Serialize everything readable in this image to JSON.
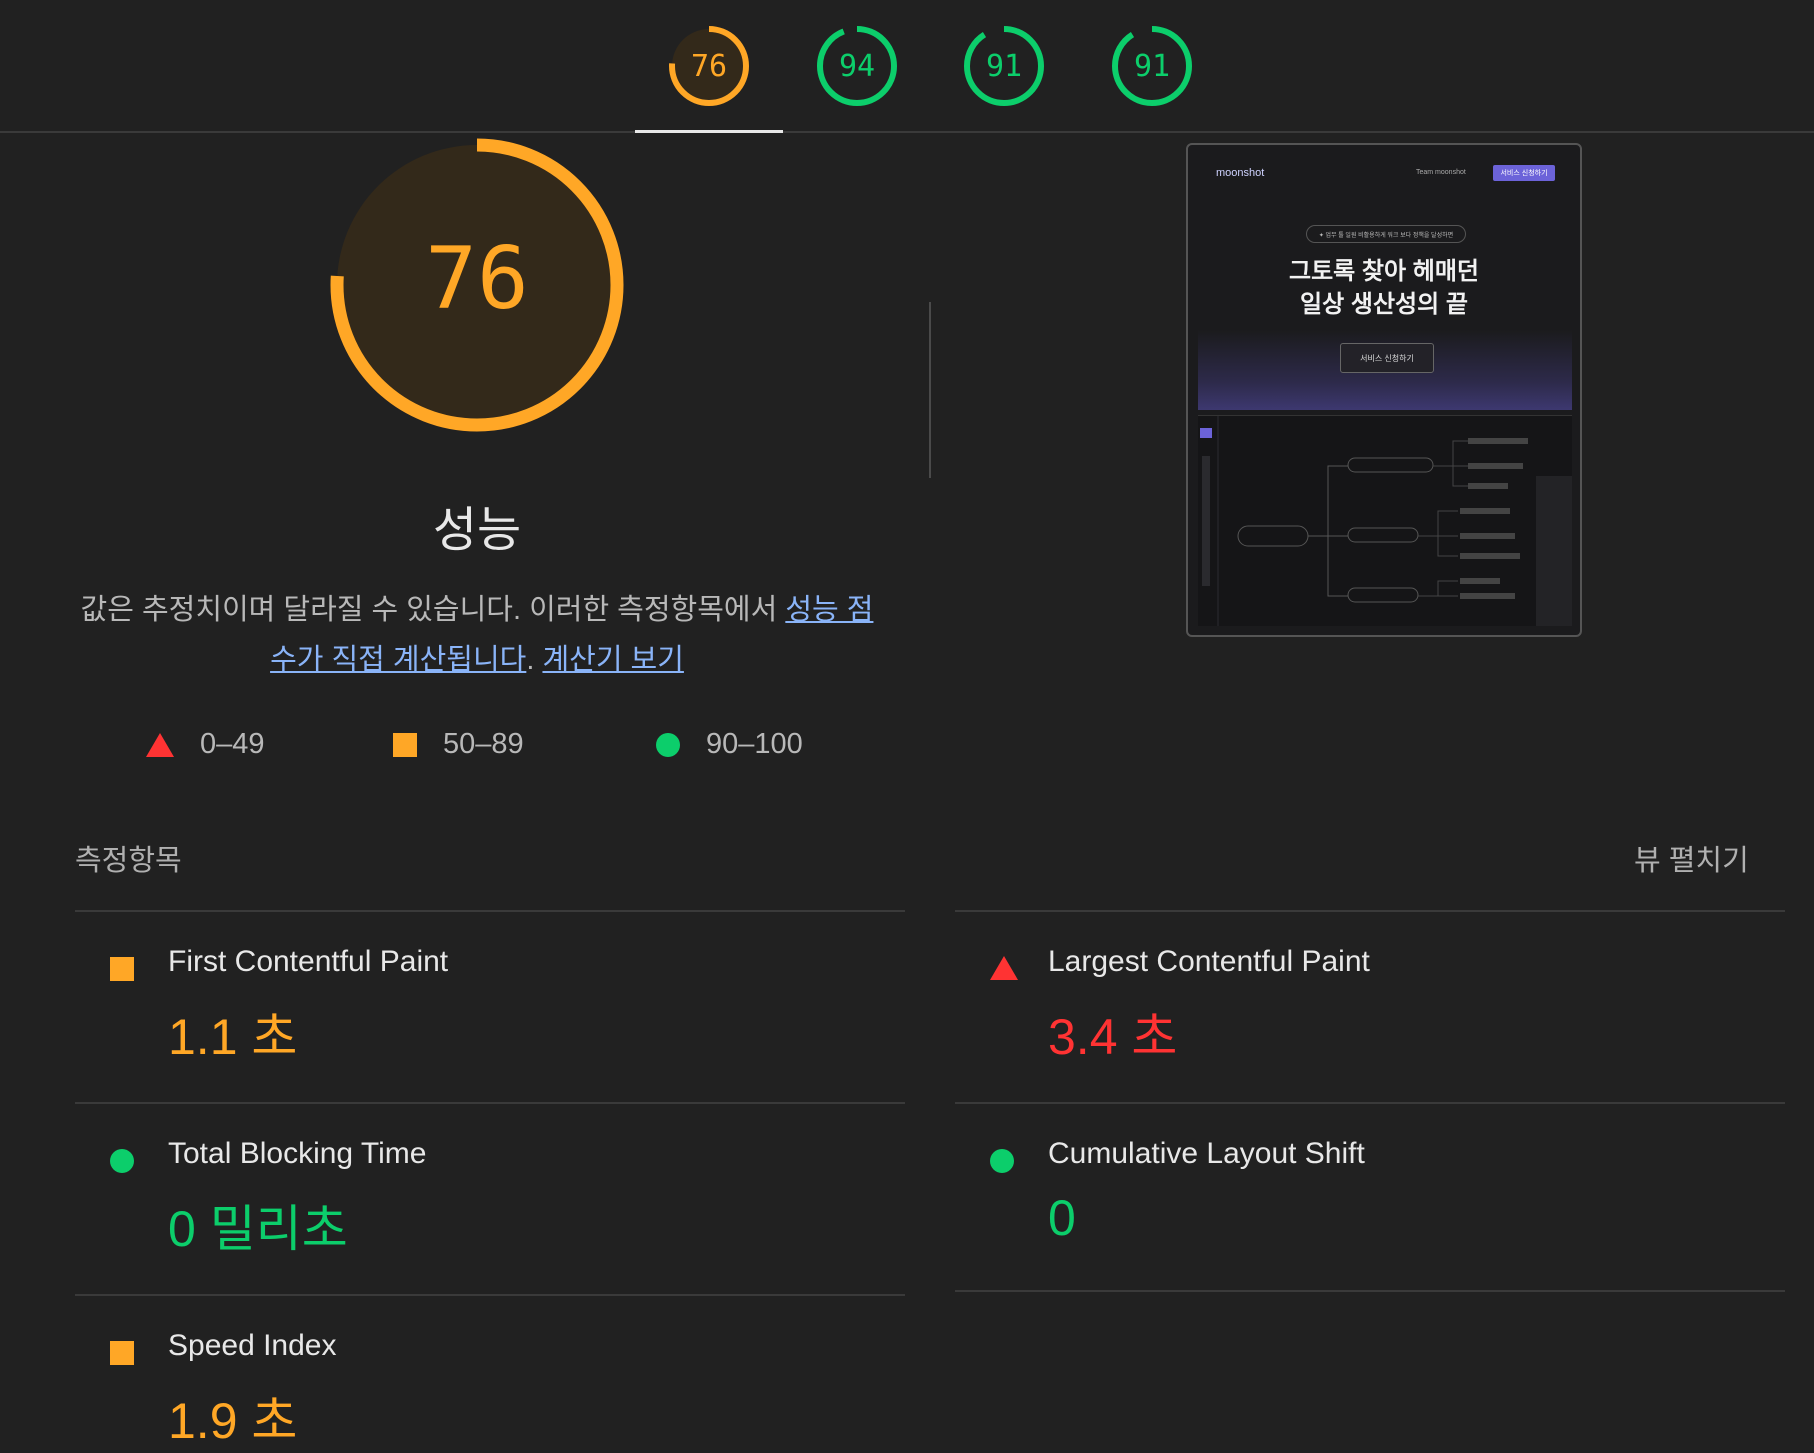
{
  "tabs": [
    {
      "score": "76",
      "fraction": 0.76,
      "color": "#ffa726",
      "active": true
    },
    {
      "score": "94",
      "fraction": 0.94,
      "color": "#0cce6b",
      "active": false
    },
    {
      "score": "91",
      "fraction": 0.91,
      "color": "#0cce6b",
      "active": false
    },
    {
      "score": "91",
      "fraction": 0.91,
      "color": "#0cce6b",
      "active": false
    }
  ],
  "category": {
    "score": "76",
    "fraction": 0.76,
    "title": "성능",
    "desc_prefix": "값은 추정치이며 달라질 수 있습니다. 이러한 측정항목에서 ",
    "desc_link1": "성능 점수가 직접 계산됩니다",
    "desc_mid": ". ",
    "desc_link2": "계산기 보기"
  },
  "legend": [
    {
      "range": "0–49",
      "shape": "triangle",
      "color": "#ff3333"
    },
    {
      "range": "50–89",
      "shape": "square",
      "color": "#ffa726"
    },
    {
      "range": "90–100",
      "shape": "circle",
      "color": "#0cce6b"
    }
  ],
  "preview": {
    "logo": "moonshot",
    "nav": "Team moonshot",
    "cta": "서비스 신청하기",
    "pill": "✦ 업무 툴 일원 비활용하게 워크 보다 정책을 달성하면",
    "headline1": "그토록 찾아 헤매던",
    "headline2": "일상 생산성의 끝",
    "button": "서비스 신청하기"
  },
  "metrics_section": {
    "title": "측정항목",
    "expand": "뷰 펼치기"
  },
  "metrics": [
    {
      "label": "First Contentful Paint",
      "value": "1.1 초",
      "status": "average"
    },
    {
      "label": "Largest Contentful Paint",
      "value": "3.4 초",
      "status": "fail"
    },
    {
      "label": "Total Blocking Time",
      "value": "0 밀리초",
      "status": "pass"
    },
    {
      "label": "Cumulative Layout Shift",
      "value": "0",
      "status": "pass"
    },
    {
      "label": "Speed Index",
      "value": "1.9 초",
      "status": "average"
    }
  ],
  "colors": {
    "pass": "#0cce6b",
    "average": "#ffa726",
    "fail": "#ff3333",
    "background": "#212121"
  }
}
